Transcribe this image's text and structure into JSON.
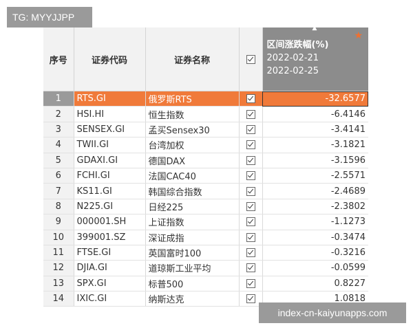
{
  "watermark_top": "TG: MYYJJPP",
  "watermark_bottom": "index-cn-kaiyunapps.com",
  "accent_color": "#f07a3a",
  "header": {
    "no": "序号",
    "code": "证券代码",
    "name": "证券名称",
    "change_title": "区间涨跌幅(%)",
    "date_start": "2022-02-21",
    "date_end": "2022-02-25"
  },
  "rows": [
    {
      "no": "1",
      "code": "RTS.GI",
      "name": "俄罗斯RTS",
      "change": "-32.6577",
      "selected": true
    },
    {
      "no": "2",
      "code": "HSI.HI",
      "name": "恒生指数",
      "change": "-6.4146"
    },
    {
      "no": "3",
      "code": "SENSEX.GI",
      "name": "孟买Sensex30",
      "change": "-3.4141"
    },
    {
      "no": "4",
      "code": "TWII.GI",
      "name": "台湾加权",
      "change": "-3.1821"
    },
    {
      "no": "5",
      "code": "GDAXI.GI",
      "name": "德国DAX",
      "change": "-3.1596"
    },
    {
      "no": "6",
      "code": "FCHI.GI",
      "name": "法国CAC40",
      "change": "-2.5571"
    },
    {
      "no": "7",
      "code": "KS11.GI",
      "name": "韩国综合指数",
      "change": "-2.4689"
    },
    {
      "no": "8",
      "code": "N225.GI",
      "name": "日经225",
      "change": "-2.3802"
    },
    {
      "no": "9",
      "code": "000001.SH",
      "name": "上证指数",
      "change": "-1.1273"
    },
    {
      "no": "10",
      "code": "399001.SZ",
      "name": "深证成指",
      "change": "-0.3474"
    },
    {
      "no": "11",
      "code": "FTSE.GI",
      "name": "英国富时100",
      "change": "-0.3216"
    },
    {
      "no": "12",
      "code": "DJIA.GI",
      "name": "道琼斯工业平均",
      "change": "-0.0599"
    },
    {
      "no": "13",
      "code": "SPX.GI",
      "name": "标普500",
      "change": "0.8227"
    },
    {
      "no": "14",
      "code": "IXIC.GI",
      "name": "纳斯达克",
      "change": "1.0818"
    }
  ]
}
